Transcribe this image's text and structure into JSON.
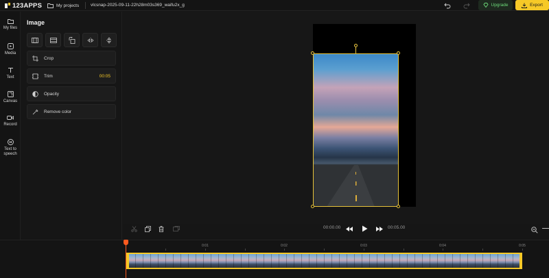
{
  "app": {
    "logo_text": "123APPS",
    "my_projects": "My projects",
    "filename": "vlcsnap-2025-09-11-22h28m03s369_waifu2x_g",
    "upgrade_label": "Upgrade",
    "export_label": "Export"
  },
  "nav": [
    {
      "label": "My files",
      "icon": "folder-icon"
    },
    {
      "label": "Media",
      "icon": "media-icon"
    },
    {
      "label": "Text",
      "icon": "text-icon"
    },
    {
      "label": "Canvas",
      "icon": "canvas-icon"
    },
    {
      "label": "Record",
      "icon": "record-icon"
    },
    {
      "label": "Text to speech",
      "icon": "tts-icon"
    }
  ],
  "panel": {
    "title": "Image",
    "options": {
      "crop": "Crop",
      "trim": "Trim",
      "trim_value": "00:05",
      "opacity": "Opacity",
      "remove_color": "Remove color"
    }
  },
  "playback": {
    "current_time": "00:00.00",
    "total_time": "00:05.00"
  },
  "timeline": {
    "ruler": [
      "0:01",
      "0:02",
      "0:03",
      "0:04",
      "0:05"
    ]
  },
  "colors": {
    "accent": "#f6c927",
    "upgrade": "#6ddc7a",
    "playhead": "#ff5a1f"
  }
}
